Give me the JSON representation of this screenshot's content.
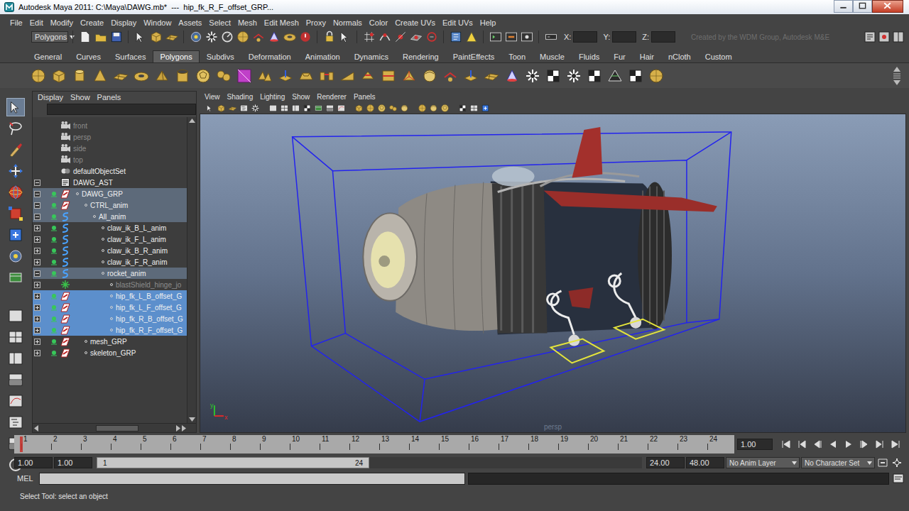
{
  "window": {
    "title": "Autodesk Maya 2011: C:\\Maya\\DAWG.mb*  ---  hip_fk_R_F_offset_GRP..."
  },
  "menu_bar": [
    "File",
    "Edit",
    "Modify",
    "Create",
    "Display",
    "Window",
    "Assets",
    "Select",
    "Mesh",
    "Edit Mesh",
    "Proxy",
    "Normals",
    "Color",
    "Create UVs",
    "Edit UVs",
    "Help"
  ],
  "status_line": {
    "menu_set": "Polygons",
    "coordinate_labels": [
      "X:",
      "Y:",
      "Z:"
    ],
    "watermark": "Created by the WDM Group, Autodesk M&E"
  },
  "shelf": {
    "tabs": [
      {
        "label": "General",
        "selected": false
      },
      {
        "label": "Curves",
        "selected": false
      },
      {
        "label": "Surfaces",
        "selected": false
      },
      {
        "label": "Polygons",
        "selected": true
      },
      {
        "label": "Subdivs",
        "selected": false
      },
      {
        "label": "Deformation",
        "selected": false
      },
      {
        "label": "Animation",
        "selected": false
      },
      {
        "label": "Dynamics",
        "selected": false
      },
      {
        "label": "Rendering",
        "selected": false
      },
      {
        "label": "PaintEffects",
        "selected": false
      },
      {
        "label": "Toon",
        "selected": false
      },
      {
        "label": "Muscle",
        "selected": false
      },
      {
        "label": "Fluids",
        "selected": false
      },
      {
        "label": "Fur",
        "selected": false
      },
      {
        "label": "Hair",
        "selected": false
      },
      {
        "label": "nCloth",
        "selected": false
      },
      {
        "label": "Custom",
        "selected": false
      }
    ]
  },
  "outliner": {
    "menu": [
      "Display",
      "Show",
      "Panels"
    ],
    "items": [
      {
        "label": "front",
        "depth": 0,
        "icon": "camera",
        "expander": "none",
        "visible": false,
        "selected": false,
        "highlighted": false,
        "dimmed": true
      },
      {
        "label": "persp",
        "depth": 0,
        "icon": "camera",
        "expander": "none",
        "visible": false,
        "selected": false,
        "highlighted": false,
        "dimmed": true
      },
      {
        "label": "side",
        "depth": 0,
        "icon": "camera",
        "expander": "none",
        "visible": false,
        "selected": false,
        "highlighted": false,
        "dimmed": true
      },
      {
        "label": "top",
        "depth": 0,
        "icon": "camera",
        "expander": "none",
        "visible": false,
        "selected": false,
        "highlighted": false,
        "dimmed": true
      },
      {
        "label": "defaultObjectSet",
        "depth": 0,
        "icon": "set",
        "expander": "none",
        "visible": false,
        "selected": false,
        "highlighted": false,
        "dimmed": false
      },
      {
        "label": "DAWG_AST",
        "depth": 0,
        "icon": "asset",
        "expander": "open",
        "visible": false,
        "selected": false,
        "highlighted": false,
        "dimmed": false
      },
      {
        "label": "DAWG_GRP",
        "depth": 1,
        "icon": "group",
        "expander": "open",
        "visible": true,
        "selected": false,
        "highlighted": true,
        "dimmed": false
      },
      {
        "label": "CTRL_anim",
        "depth": 2,
        "icon": "group",
        "expander": "open",
        "visible": true,
        "selected": false,
        "highlighted": true,
        "dimmed": false
      },
      {
        "label": "All_anim",
        "depth": 3,
        "icon": "curve",
        "expander": "open",
        "visible": true,
        "selected": false,
        "highlighted": true,
        "dimmed": false
      },
      {
        "label": "claw_ik_B_L_anim",
        "depth": 4,
        "icon": "curve",
        "expander": "closed",
        "visible": true,
        "selected": false,
        "highlighted": false,
        "dimmed": false
      },
      {
        "label": "claw_ik_F_L_anim",
        "depth": 4,
        "icon": "curve",
        "expander": "closed",
        "visible": true,
        "selected": false,
        "highlighted": false,
        "dimmed": false
      },
      {
        "label": "claw_ik_B_R_anim",
        "depth": 4,
        "icon": "curve",
        "expander": "closed",
        "visible": true,
        "selected": false,
        "highlighted": false,
        "dimmed": false
      },
      {
        "label": "claw_ik_F_R_anim",
        "depth": 4,
        "icon": "curve",
        "expander": "closed",
        "visible": true,
        "selected": false,
        "highlighted": false,
        "dimmed": false
      },
      {
        "label": "rocket_anim",
        "depth": 4,
        "icon": "curve",
        "expander": "open",
        "visible": true,
        "selected": false,
        "highlighted": true,
        "dimmed": false
      },
      {
        "label": "blastShield_hinge_jo",
        "depth": 5,
        "icon": "joint",
        "expander": "closed",
        "visible": false,
        "selected": false,
        "highlighted": false,
        "dimmed": true
      },
      {
        "label": "hip_fk_L_B_offset_G",
        "depth": 5,
        "icon": "group",
        "expander": "closed",
        "visible": true,
        "selected": true,
        "highlighted": false,
        "dimmed": false
      },
      {
        "label": "hip_fk_L_F_offset_G",
        "depth": 5,
        "icon": "group",
        "expander": "closed",
        "visible": true,
        "selected": true,
        "highlighted": false,
        "dimmed": false
      },
      {
        "label": "hip_fk_R_B_offset_G",
        "depth": 5,
        "icon": "group",
        "expander": "closed",
        "visible": true,
        "selected": true,
        "highlighted": false,
        "dimmed": false
      },
      {
        "label": "hip_fk_R_F_offset_G",
        "depth": 5,
        "icon": "group",
        "expander": "closed",
        "visible": true,
        "selected": true,
        "highlighted": false,
        "dimmed": false
      },
      {
        "label": "mesh_GRP",
        "depth": 2,
        "icon": "group",
        "expander": "closed",
        "visible": true,
        "selected": false,
        "highlighted": false,
        "dimmed": false
      },
      {
        "label": "skeleton_GRP",
        "depth": 2,
        "icon": "group",
        "expander": "closed",
        "visible": true,
        "selected": false,
        "highlighted": false,
        "dimmed": false
      }
    ]
  },
  "viewport": {
    "menu": [
      "View",
      "Shading",
      "Lighting",
      "Show",
      "Renderer",
      "Panels"
    ],
    "camera": "persp",
    "axis_labels": {
      "y": "y",
      "x": "x"
    }
  },
  "time_slider": {
    "frames": [
      "1",
      "2",
      "3",
      "4",
      "5",
      "6",
      "7",
      "8",
      "9",
      "10",
      "11",
      "12",
      "13",
      "14",
      "15",
      "16",
      "17",
      "18",
      "19",
      "20",
      "21",
      "22",
      "23",
      "24"
    ],
    "current_frame": "1.00",
    "playhead_level": 0
  },
  "range_slider": {
    "start": "1.00",
    "range_start": "1.00",
    "bar_start": "1",
    "bar_end": "24",
    "range_end": "24.00",
    "end": "48.00",
    "bar_level": 0.5,
    "anim_layer": "No Anim Layer",
    "character_set": "No Character Set"
  },
  "command_line": {
    "language": "MEL"
  },
  "help_line": "Select Tool: select an object"
}
